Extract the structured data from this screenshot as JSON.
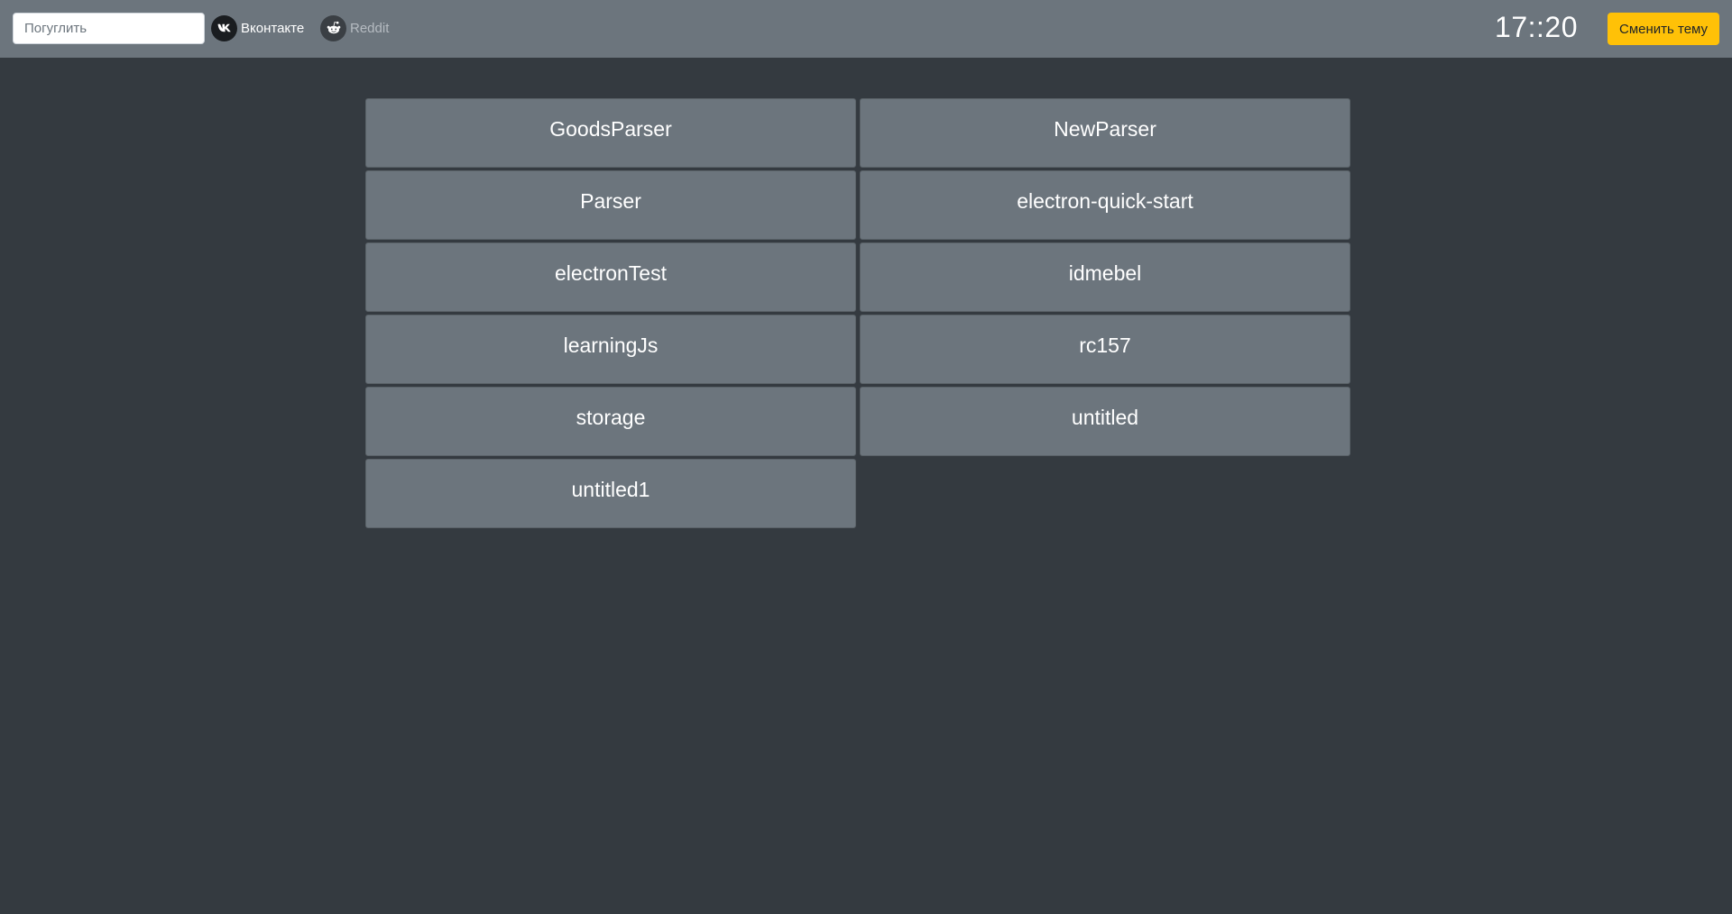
{
  "header": {
    "search": {
      "placeholder": "Погуглить",
      "value": ""
    },
    "links": [
      {
        "label": "Вконтакте",
        "icon": "vk-icon"
      },
      {
        "label": "Reddit",
        "icon": "reddit-icon"
      }
    ],
    "clock": "17::20",
    "theme_button_label": "Сменить тему"
  },
  "projects": [
    {
      "label": "GoodsParser"
    },
    {
      "label": "NewParser"
    },
    {
      "label": "Parser"
    },
    {
      "label": "electron-quick-start"
    },
    {
      "label": "electronTest"
    },
    {
      "label": "idmebel"
    },
    {
      "label": "learningJs"
    },
    {
      "label": "rc157"
    },
    {
      "label": "storage"
    },
    {
      "label": "untitled"
    },
    {
      "label": "untitled1"
    }
  ],
  "colors": {
    "background": "#343a40",
    "header": "#6c757d",
    "tile": "#6c757d",
    "accent_button": "#ffc107"
  }
}
